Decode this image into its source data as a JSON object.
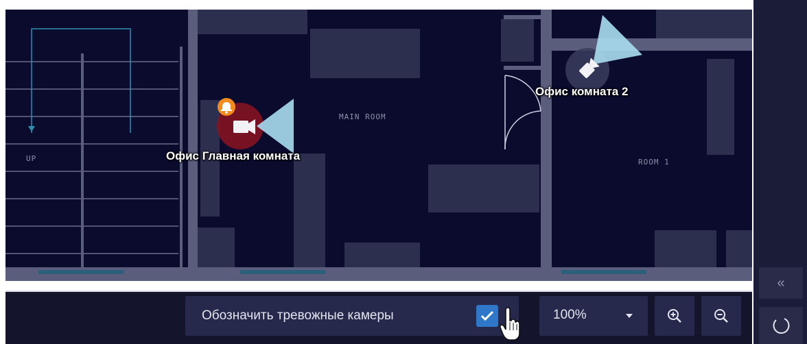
{
  "map": {
    "rooms": {
      "main_room": "MAIN ROOM",
      "room_1": "ROOM 1",
      "stairs": "UP"
    },
    "cameras": [
      {
        "name": "Офис Главная комната",
        "status": "alarm",
        "icon": "camera-icon",
        "badge": "bell-icon",
        "highlight_color": "#8a1420"
      },
      {
        "name": "Офис комната 2",
        "status": "normal",
        "icon": "camera-icon"
      }
    ],
    "colors": {
      "background": "#0b0b2e",
      "walls": "#5a5d7c",
      "furniture": "#2c2f4e",
      "fov": "#a8dbf0",
      "alarm_badge": "#f28c1e"
    }
  },
  "bottom_bar": {
    "alarm_toggle": {
      "label": "Обозначить тревожные камеры",
      "checked": true
    },
    "zoom": {
      "value": "100%"
    },
    "zoom_in": "zoom-in-icon",
    "zoom_out": "zoom-out-icon"
  },
  "side_panel": {
    "collapse_label": "«",
    "refresh": "refresh-icon"
  },
  "accent_color": "#2f77c8"
}
